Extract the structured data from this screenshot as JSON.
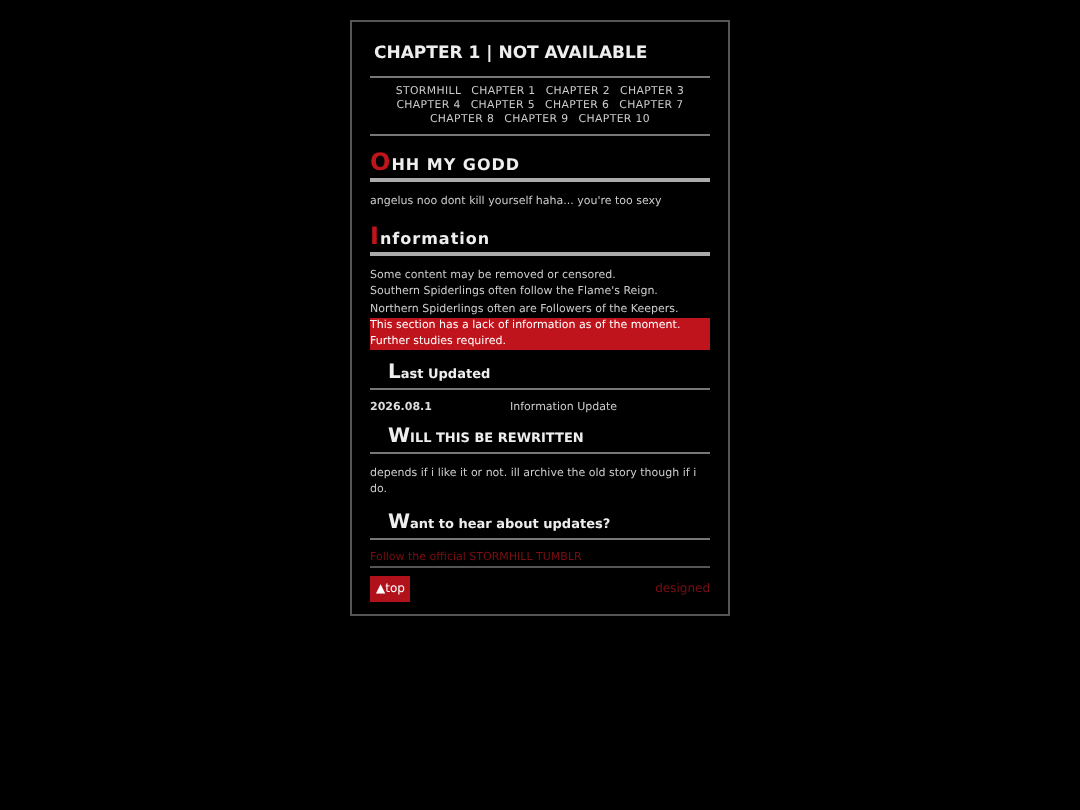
{
  "title": "CHAPTER 1 | NOT AVAILABLE",
  "nav": [
    "STORMHILL",
    "CHAPTER 1",
    "CHAPTER 2",
    "CHAPTER 3",
    "CHAPTER 4",
    "CHAPTER 5",
    "CHAPTER 6",
    "CHAPTER 7",
    "CHAPTER 8",
    "CHAPTER 9",
    "CHAPTER 10"
  ],
  "sections": [
    {
      "kind": "major",
      "heading": "OHH MY GODD",
      "lines": [
        {
          "text": "angelus noo dont kill yourself haha... you're too sexy",
          "highlight": false
        }
      ]
    },
    {
      "kind": "major",
      "heading": "Information",
      "lines": [
        {
          "text": "Some content may be removed or censored.\nSouthern Spiderlings often follow the Flame's Reign.\nNorthern Spiderlings often are Followers of the Keepers.",
          "highlight": false
        },
        {
          "text": "This section has a lack of information as of the moment. Further studies required.",
          "highlight": true
        }
      ]
    },
    {
      "kind": "minor",
      "heading": "Last Updated",
      "row": [
        "2026.08.1",
        "Information Update"
      ]
    },
    {
      "kind": "minor",
      "heading": "WILL THIS BE REWRITTEN",
      "lines": [
        {
          "text": "depends if i like it or not. ill archive the old story though if i do.",
          "highlight": false
        }
      ]
    },
    {
      "kind": "minor",
      "heading": "Want to hear about updates?",
      "link": "Follow the official STORMHILL TUMBLR"
    }
  ],
  "footer": {
    "top": "▲top",
    "credit": "designed"
  }
}
